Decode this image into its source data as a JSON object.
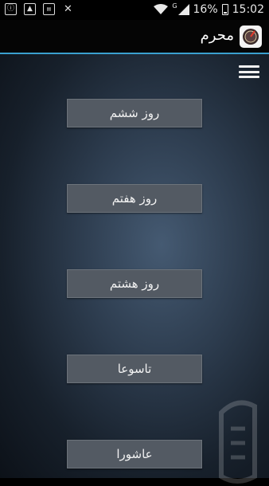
{
  "status_bar": {
    "battery_percent": "16%",
    "time": "15:02",
    "network_label": "G",
    "left_icons": [
      "alarm-icon",
      "gallery-icon",
      "store-icon",
      "close-notification-icon"
    ]
  },
  "app_bar": {
    "title": "محرم"
  },
  "menu": {
    "items": [
      {
        "label": "روز ششم"
      },
      {
        "label": "روز هفتم"
      },
      {
        "label": "روز هشتم"
      },
      {
        "label": "تاسوعا"
      },
      {
        "label": "عاشورا"
      }
    ]
  },
  "colors": {
    "accent": "#3aa0cf",
    "button_bg": "#535a63"
  }
}
